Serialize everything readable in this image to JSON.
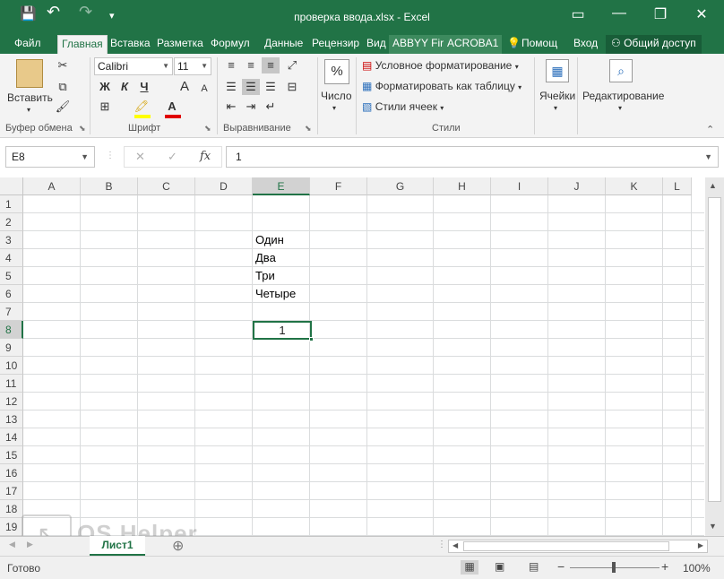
{
  "window": {
    "title": "проверка ввода.xlsx - Excel",
    "minimize": "—",
    "restore": "❐",
    "close": "✕",
    "ribbon_display": "▭"
  },
  "quick_access": {
    "save": "💾",
    "undo": "↶",
    "redo": "↷",
    "customize": "▾"
  },
  "tabs": [
    "Файл",
    "Главная",
    "Вставка",
    "Разметка",
    "Формул",
    "Данные",
    "Рецензир",
    "Вид",
    "ABBYY Fir",
    "ACROBA1"
  ],
  "active_tab": "Главная",
  "tell_me": "Помощ",
  "signin": "Вход",
  "share": "Общий доступ",
  "ribbon": {
    "clipboard": {
      "label": "Буфер обмена",
      "paste": "Вставить"
    },
    "font": {
      "label": "Шрифт",
      "name": "Calibri",
      "size": "11",
      "bold": "Ж",
      "italic": "К",
      "underline": "Ч",
      "grow": "A",
      "shrink": "A"
    },
    "alignment": {
      "label": "Выравнивание"
    },
    "number": {
      "label": "Число",
      "icon": "%"
    },
    "styles": {
      "label": "Стили",
      "conditional": "Условное форматирование",
      "as_table": "Форматировать как таблицу",
      "cell_styles": "Стили ячеек"
    },
    "cells": {
      "label": "Ячейки"
    },
    "editing": {
      "label": "Редактирование"
    }
  },
  "formula_bar": {
    "name_box": "E8",
    "cancel": "✕",
    "enter": "✓",
    "fx": "fx",
    "value": "1"
  },
  "columns": [
    "A",
    "B",
    "C",
    "D",
    "E",
    "F",
    "G",
    "H",
    "I",
    "J",
    "K",
    "L"
  ],
  "selected_column": "E",
  "rows": [
    "1",
    "2",
    "3",
    "4",
    "5",
    "6",
    "7",
    "8",
    "9",
    "10",
    "11",
    "12",
    "13",
    "14",
    "15",
    "16",
    "17",
    "18",
    "19"
  ],
  "selected_row": "8",
  "cells": {
    "E3": "Один",
    "E4": "Два",
    "E5": "Три",
    "E6": "Четыре",
    "E8": "1"
  },
  "sheet": {
    "name": "Лист1",
    "add": "⊕"
  },
  "status": {
    "ready": "Готово",
    "zoom": "100%",
    "minus": "−",
    "plus": "+"
  },
  "watermark": "OS Helper"
}
